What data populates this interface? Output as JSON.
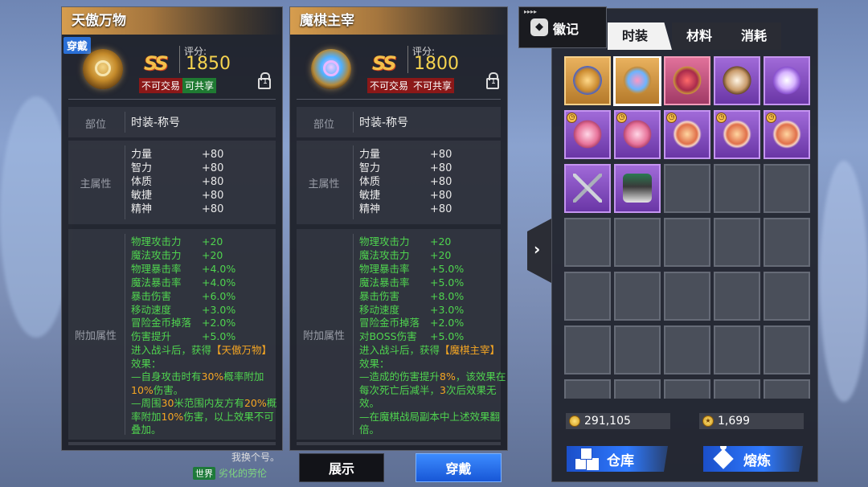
{
  "left_panel": {
    "title": "天傲万物",
    "equipped_tag": "穿戴",
    "score_label": "评分:",
    "score": "1850",
    "grade": "SS",
    "badge_trade": "不可交易",
    "badge_share": "可共享",
    "slot_label": "部位",
    "slot_value": "时装-称号",
    "main_attr_label": "主属性",
    "main_attrs": [
      {
        "name": "力量",
        "value": "+80"
      },
      {
        "name": "智力",
        "value": "+80"
      },
      {
        "name": "体质",
        "value": "+80"
      },
      {
        "name": "敏捷",
        "value": "+80"
      },
      {
        "name": "精神",
        "value": "+80"
      }
    ],
    "extra_attr_label": "附加属性",
    "extra_attrs": [
      {
        "name": "物理攻击力",
        "value": "+20"
      },
      {
        "name": "魔法攻击力",
        "value": "+20"
      },
      {
        "name": "物理暴击率",
        "value": "+4.0%"
      },
      {
        "name": "魔法暴击率",
        "value": "+4.0%"
      },
      {
        "name": "暴击伤害",
        "value": "+6.0%"
      },
      {
        "name": "移动速度",
        "value": "+3.0%"
      },
      {
        "name": "冒险金币掉落",
        "value": "+2.0%"
      },
      {
        "name": "伤害提升",
        "value": "+5.0%"
      }
    ],
    "effect_intro_1": "进入战斗后，获得",
    "effect_name": "【天傲万物】",
    "effect_intro_2": "效果：",
    "effect_line_1a": "—自身攻击时有",
    "effect_line_1b": "30%",
    "effect_line_1c": "概率附加",
    "effect_line_1d": "10%",
    "effect_line_1e": "伤害。",
    "effect_line_2a": "—周围",
    "effect_line_2b": "30",
    "effect_line_2c": "米范围内友方有",
    "effect_line_2d": "20%",
    "effect_line_2e": "概率附加",
    "effect_line_2f": "10%",
    "effect_line_2g": "伤害，以上效果不可叠加。"
  },
  "mid_panel": {
    "title": "魔棋主宰",
    "score_label": "评分:",
    "score": "1800",
    "grade": "SS",
    "badge_trade": "不可交易",
    "badge_share": "不可共享",
    "slot_label": "部位",
    "slot_value": "时装-称号",
    "main_attr_label": "主属性",
    "main_attrs": [
      {
        "name": "力量",
        "value": "+80"
      },
      {
        "name": "智力",
        "value": "+80"
      },
      {
        "name": "体质",
        "value": "+80"
      },
      {
        "name": "敏捷",
        "value": "+80"
      },
      {
        "name": "精神",
        "value": "+80"
      }
    ],
    "extra_attr_label": "附加属性",
    "extra_attrs": [
      {
        "name": "物理攻击力",
        "value": "+20"
      },
      {
        "name": "魔法攻击力",
        "value": "+20"
      },
      {
        "name": "物理暴击率",
        "value": "+5.0%"
      },
      {
        "name": "魔法暴击率",
        "value": "+5.0%"
      },
      {
        "name": "暴击伤害",
        "value": "+8.0%"
      },
      {
        "name": "移动速度",
        "value": "+3.0%"
      },
      {
        "name": "冒险金币掉落",
        "value": "+2.0%"
      },
      {
        "name": "对BOSS伤害",
        "value": "+5.0%"
      }
    ],
    "effect_intro_1": "进入战斗后，获得",
    "effect_name": "【魔棋主宰】",
    "effect_intro_2": "效果：",
    "effect_line_1a": "—造成的伤害提升",
    "effect_line_1b": "8%",
    "effect_line_1c": "，该效果在每次死亡后减半，",
    "effect_line_1d": "3",
    "effect_line_1e": "次后效果无效。",
    "effect_line_2": "—在魔棋战局副本中上述效果翻倍。"
  },
  "buttons": {
    "show": "展示",
    "wear": "穿戴"
  },
  "chat": {
    "line1": "我换个号。",
    "channel": "世界",
    "line2": "劣化的劳伦"
  },
  "inventory": {
    "emblem_tab": "徽记",
    "tabs": [
      "时装",
      "材料",
      "消耗"
    ],
    "active_tab": 0,
    "rows": [
      [
        {
          "art": "crown",
          "rarity": "gold",
          "timed": false
        },
        {
          "art": "crown2",
          "rarity": "gold",
          "timed": false,
          "selected": true
        },
        {
          "art": "ruby",
          "rarity": "pink",
          "timed": false
        },
        {
          "art": "disc",
          "rarity": "purple",
          "timed": false
        },
        {
          "art": "balloon",
          "rarity": "purple",
          "timed": false
        }
      ],
      [
        {
          "art": "pinkdisc",
          "rarity": "purple",
          "timed": true
        },
        {
          "art": "pinkdisc",
          "rarity": "purple",
          "timed": true
        },
        {
          "art": "gcoin",
          "rarity": "purple",
          "timed": true
        },
        {
          "art": "gcoin",
          "rarity": "purple",
          "timed": true
        },
        {
          "art": "gcoin",
          "rarity": "purple",
          "timed": true
        }
      ],
      [
        {
          "art": "swords",
          "rarity": "purple",
          "timed": false
        },
        {
          "art": "cloak",
          "rarity": "purple",
          "timed": false
        },
        null,
        null,
        null
      ],
      [
        null,
        null,
        null,
        null,
        null
      ],
      [
        null,
        null,
        null,
        null,
        null
      ],
      [
        null,
        null,
        null,
        null,
        null
      ],
      [
        null,
        null,
        null,
        null,
        null
      ]
    ],
    "currency_1": "291,105",
    "currency_2": "1,699",
    "storage_label": "仓库",
    "smelt_label": "熔炼"
  },
  "colors": {
    "accent_blue": "#2f7aff",
    "positive_green": "#4fd44f",
    "highlight_orange": "#f5a623",
    "score_gold": "#f5d34f"
  }
}
